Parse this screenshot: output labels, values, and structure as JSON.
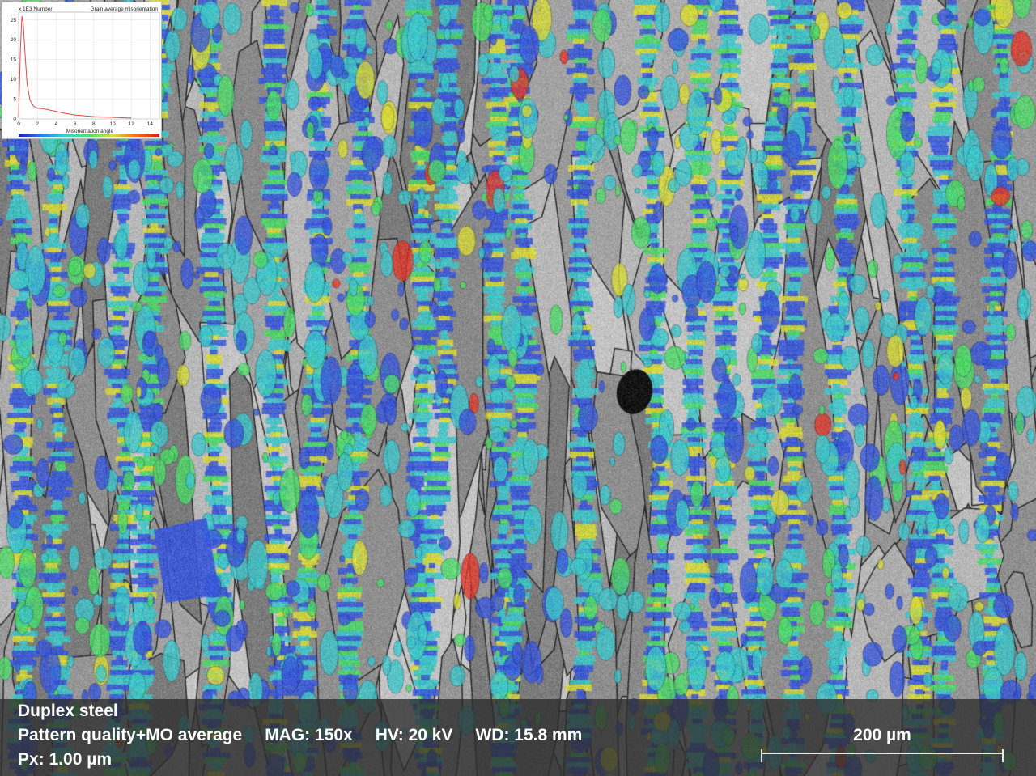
{
  "image": {
    "description_colors": {
      "background_gray": "#9a9a9a",
      "boundary": "#2a2a2a",
      "blue": "#3a58d8",
      "cyan": "#3fc6c9",
      "green": "#4fd868",
      "yellow": "#d6d838",
      "red": "#e03a2a",
      "dark_void": "#151515"
    }
  },
  "inset": {
    "y_unit_label": "x 1E3  Number",
    "title": "Grain average misorientation",
    "xlabel": "Misorientation angle",
    "colorbar": [
      "#1d1dc8",
      "#2a7fe8",
      "#35d4d4",
      "#46e070",
      "#d8e03a",
      "#ff6a20",
      "#e01818"
    ]
  },
  "chart_data": {
    "type": "line",
    "title": "Grain average misorientation",
    "xlabel": "Misorientation angle",
    "ylabel": "x 1E3  Number",
    "xlim": [
      0,
      15
    ],
    "ylim": [
      0,
      27
    ],
    "xticks": [
      0,
      2,
      4,
      6,
      8,
      10,
      12,
      14
    ],
    "yticks": [
      0,
      5,
      10,
      15,
      20,
      25
    ],
    "series": [
      {
        "x": [
          0.0,
          0.2,
          0.35,
          0.5,
          0.7,
          0.9,
          1.2,
          1.6,
          2.0,
          2.5,
          3.0,
          4.0,
          5.0,
          6.0,
          7.0,
          8.0,
          9.0,
          10.0,
          11.0,
          12.0
        ],
        "values": [
          0.3,
          18,
          26,
          24,
          16,
          9,
          4.8,
          3.2,
          2.7,
          2.6,
          2.4,
          1.9,
          1.4,
          1.0,
          0.8,
          0.6,
          0.5,
          0.4,
          0.3,
          0.2
        ]
      }
    ],
    "grid": true,
    "color": "#e04848"
  },
  "info": {
    "sample": "Duplex steel",
    "map_type": "Pattern quality+MO average",
    "mag": "MAG: 150x",
    "hv": "HV: 20 kV",
    "wd": "WD: 15.8 mm",
    "px": "Px: 1.00 µm"
  },
  "scalebar": {
    "label": "200 µm"
  }
}
